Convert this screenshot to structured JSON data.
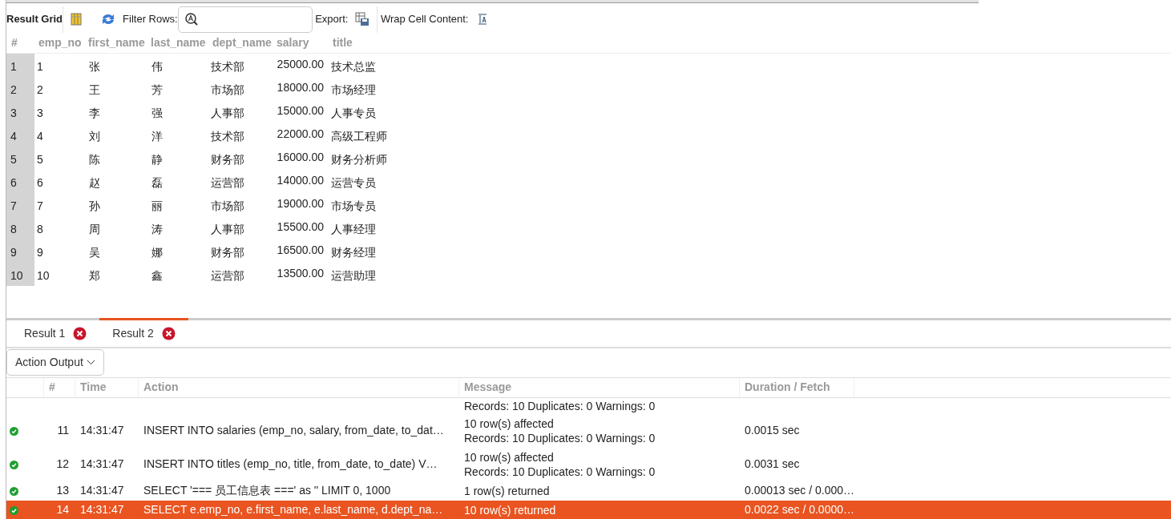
{
  "toolbar": {
    "result_grid_label": "Result Grid",
    "filter_label": "Filter Rows:",
    "export_label": "Export:",
    "wrap_label": "Wrap Cell Content:"
  },
  "grid": {
    "columns": [
      "#",
      "emp_no",
      "first_name",
      "last_name",
      "dept_name",
      "salary",
      "title"
    ],
    "rows": [
      {
        "cells": [
          "1",
          "1",
          "张",
          "伟",
          "技术部",
          "25000.00",
          "技术总监"
        ]
      },
      {
        "cells": [
          "2",
          "2",
          "王",
          "芳",
          "市场部",
          "18000.00",
          "市场经理"
        ]
      },
      {
        "cells": [
          "3",
          "3",
          "李",
          "强",
          "人事部",
          "15000.00",
          "人事专员"
        ]
      },
      {
        "cells": [
          "4",
          "4",
          "刘",
          "洋",
          "技术部",
          "22000.00",
          "高级工程师"
        ]
      },
      {
        "cells": [
          "5",
          "5",
          "陈",
          "静",
          "财务部",
          "16000.00",
          "财务分析师"
        ]
      },
      {
        "cells": [
          "6",
          "6",
          "赵",
          "磊",
          "运营部",
          "14000.00",
          "运营专员"
        ]
      },
      {
        "cells": [
          "7",
          "7",
          "孙",
          "丽",
          "市场部",
          "19000.00",
          "市场专员"
        ]
      },
      {
        "cells": [
          "8",
          "8",
          "周",
          "涛",
          "人事部",
          "15500.00",
          "人事经理"
        ]
      },
      {
        "cells": [
          "9",
          "9",
          "吴",
          "娜",
          "财务部",
          "16500.00",
          "财务经理"
        ]
      },
      {
        "cells": [
          "10",
          "10",
          "郑",
          "鑫",
          "运营部",
          "13500.00",
          "运营助理"
        ]
      }
    ]
  },
  "result_tabs": [
    {
      "label": "Result 1",
      "selected": false
    },
    {
      "label": "Result 2",
      "selected": true
    }
  ],
  "output": {
    "dropdown": "Action Output",
    "columns": [
      "#",
      "Time",
      "Action",
      "Message",
      "Duration / Fetch"
    ],
    "rows": [
      {
        "message": [
          "Records: 10  Duplicates: 0  Warnings: 0"
        ],
        "selected": false
      },
      {
        "number": "11",
        "time": "14:31:47",
        "action": "INSERT INTO salaries (emp_no, salary, from_date, to_dat…",
        "message": [
          "10 row(s) affected",
          "Records: 10  Duplicates: 0  Warnings: 0"
        ],
        "duration": "0.0015 sec",
        "selected": false
      },
      {
        "number": "12",
        "time": "14:31:47",
        "action": "INSERT INTO titles (emp_no, title, from_date, to_date) V…",
        "message": [
          "10 row(s) affected",
          "Records: 10  Duplicates: 0  Warnings: 0"
        ],
        "duration": "0.0031 sec",
        "selected": false
      },
      {
        "number": "13",
        "time": "14:31:47",
        "action": "SELECT '=== 员工信息表 ===' as '' LIMIT 0, 1000",
        "message": [
          "1 row(s) returned"
        ],
        "duration": "0.00013 sec / 0.000…",
        "selected": false
      },
      {
        "number": "14",
        "time": "14:31:47",
        "action": "SELECT e.emp_no, e.first_name, e.last_name, d.dept_na…",
        "message": [
          "10 row(s) returned"
        ],
        "duration": "0.0022 sec / 0.0000…",
        "selected": true
      }
    ]
  }
}
